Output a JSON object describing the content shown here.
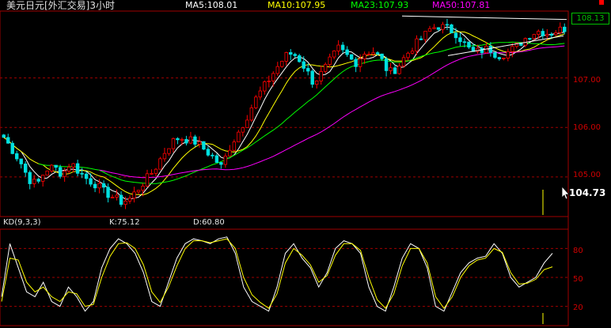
{
  "header": {
    "title": "美元日元[外汇交易]3小时",
    "ma5": "MA5:108.01",
    "ma10": "MA10:107.95",
    "ma23": "MA23:107.93",
    "ma50": "MA50:107.81"
  },
  "price_axis": {
    "ticks": [
      "105.00",
      "106.00",
      "107.00"
    ],
    "last_price": "108.13",
    "cursor_price": "104.73"
  },
  "kd_panel": {
    "title": "KD(9,3,3)",
    "k_label": "K:75.12",
    "d_label": "D:60.80",
    "ticks": [
      "20",
      "50",
      "80"
    ]
  },
  "colors": {
    "up_candle": "#ff0000",
    "down_candle": "#00e0e0",
    "ma5": "#ffffff",
    "ma10": "#ffff00",
    "ma23": "#00ff00",
    "ma50": "#ff00ff",
    "grid": "#a00000",
    "axis_text": "#d00000",
    "kd_k": "#ffffff",
    "kd_d": "#ffff00"
  },
  "chart_data": [
    {
      "type": "candlestick",
      "title": "美元日元[外汇交易]3小时",
      "ylim": [
        104.2,
        108.35
      ],
      "yticks": [
        105,
        106,
        107
      ],
      "close_path": [
        105.8,
        105.55,
        105.3,
        104.95,
        104.85,
        105.15,
        105.2,
        105.05,
        105.3,
        105.1,
        104.95,
        104.85,
        104.7,
        104.6,
        104.5,
        104.55,
        104.75,
        104.95,
        105.15,
        105.45,
        105.7,
        105.8,
        105.75,
        105.7,
        105.55,
        105.4,
        105.2,
        105.6,
        105.9,
        106.2,
        106.55,
        106.8,
        107.05,
        107.3,
        107.5,
        107.45,
        107.2,
        106.9,
        107.1,
        107.35,
        107.6,
        107.45,
        107.3,
        107.5,
        107.55,
        107.4,
        107.1,
        107.2,
        107.45,
        107.65,
        107.8,
        108.0,
        108.05,
        108.0,
        107.9,
        107.7,
        107.5,
        107.55,
        107.6,
        107.45,
        107.5,
        107.6,
        107.75,
        107.9,
        107.95,
        107.9,
        107.95,
        108.0
      ],
      "moving_averages": [
        {
          "name": "MA5",
          "last": 108.01
        },
        {
          "name": "MA10",
          "last": 107.95
        },
        {
          "name": "MA23",
          "last": 107.93
        },
        {
          "name": "MA50",
          "last": 107.81
        }
      ],
      "last_price": 108.13,
      "cursor_price": 104.73
    },
    {
      "type": "line",
      "title": "KD(9,3,3)",
      "ylim": [
        0,
        100
      ],
      "yticks": [
        20,
        50,
        80
      ],
      "series": [
        {
          "name": "K",
          "last": 75.12,
          "values": [
            30,
            85,
            60,
            35,
            30,
            45,
            25,
            20,
            40,
            30,
            15,
            25,
            60,
            80,
            90,
            85,
            75,
            55,
            25,
            20,
            45,
            70,
            85,
            90,
            88,
            85,
            90,
            92,
            75,
            40,
            25,
            20,
            15,
            40,
            75,
            85,
            70,
            60,
            40,
            55,
            80,
            88,
            85,
            75,
            40,
            20,
            15,
            40,
            70,
            85,
            80,
            60,
            20,
            15,
            35,
            55,
            65,
            70,
            72,
            85,
            75,
            50,
            40,
            45,
            50,
            65,
            75
          ]
        },
        {
          "name": "D",
          "last": 60.8,
          "values": [
            25,
            70,
            68,
            45,
            35,
            40,
            30,
            25,
            35,
            33,
            20,
            22,
            50,
            72,
            85,
            86,
            80,
            63,
            35,
            24,
            40,
            62,
            80,
            88,
            88,
            86,
            88,
            90,
            80,
            50,
            32,
            24,
            18,
            33,
            65,
            80,
            73,
            63,
            45,
            52,
            73,
            85,
            85,
            78,
            50,
            27,
            18,
            33,
            62,
            80,
            80,
            65,
            30,
            18,
            30,
            50,
            62,
            68,
            70,
            80,
            76,
            55,
            43,
            44,
            48,
            58,
            61
          ]
        }
      ]
    }
  ]
}
